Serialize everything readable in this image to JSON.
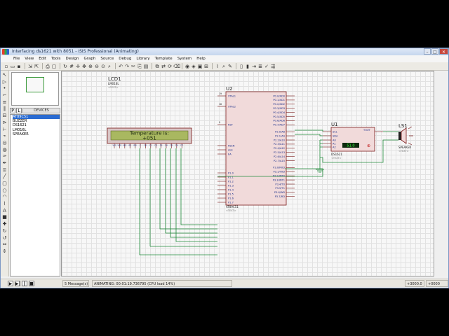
{
  "window": {
    "title": "Interfacing ds1621 with 8051 - ISIS Professional (Animating)",
    "controls": {
      "minimize": "–",
      "maximize": "□",
      "close": "✕"
    }
  },
  "menu": [
    "File",
    "View",
    "Edit",
    "Tools",
    "Design",
    "Graph",
    "Source",
    "Debug",
    "Library",
    "Template",
    "System",
    "Help"
  ],
  "picker": {
    "p_label": "P",
    "l_label": "L",
    "header": "DEVICES",
    "devices": [
      "AT89C51",
      "BUZZER",
      "DS1621",
      "LM016L",
      "SPEAKER"
    ],
    "selected": 0
  },
  "schematic": {
    "lcd": {
      "ref": "LCD1",
      "part": "LM016L",
      "text_tag": "<TEXT>",
      "line1": "Temperature is:",
      "line2": "+051",
      "pins": [
        "VSS",
        "VDD",
        "VEE",
        "RS",
        "RW",
        "E",
        "D0",
        "D1",
        "D2",
        "D3",
        "D4",
        "D5",
        "D6",
        "D7"
      ]
    },
    "mcu": {
      "ref": "U2",
      "part": "AT89C51",
      "text_tag": "<TEXT>",
      "left_pins": [
        "XTAL1",
        "XTAL2",
        "RST",
        "PSEN",
        "ALE",
        "EA",
        "P1.0",
        "P1.1",
        "P1.2",
        "P1.3",
        "P1.4",
        "P1.5",
        "P1.6",
        "P1.7"
      ],
      "right_pins": [
        "P0.0/AD0",
        "P0.1/AD1",
        "P0.2/AD2",
        "P0.3/AD3",
        "P0.4/AD4",
        "P0.5/AD5",
        "P0.6/AD6",
        "P0.7/AD7",
        "P2.0/A8",
        "P2.1/A9",
        "P2.2/A10",
        "P2.3/A11",
        "P2.4/A12",
        "P2.5/A13",
        "P2.6/A14",
        "P2.7/A15",
        "P3.0/RXD",
        "P3.1/TXD",
        "P3.2/INT0",
        "P3.3/INT1",
        "P3.4/T0",
        "P3.5/T1",
        "P3.6/WR",
        "P3.7/RD"
      ],
      "pin_numbers": {
        "xtal1": "19",
        "xtal2": "18",
        "rst": "9"
      }
    },
    "sensor": {
      "ref": "U1",
      "part": "DS1621",
      "text_tag": "<TEXT>",
      "pins": [
        "SCL",
        "SDA",
        "A0",
        "A1",
        "A2"
      ],
      "tout": "TOUT",
      "display": "51.0"
    },
    "speaker": {
      "ref": "LS1",
      "part": "SPEAKER",
      "text_tag": "<TEXT>"
    }
  },
  "status": {
    "messages": "5 Message(s)",
    "sim": "ANIMATING: 00:01:19.736795 (CPU load 14%)",
    "coord": "+3000.0",
    "coord2": "+0000"
  },
  "colors": {
    "lcd_bg": "#a9b860",
    "lcd_text": "#1d2a10",
    "component_fill": "#f1dada",
    "component_border": "#7a1a1a",
    "wire": "#1f8a3a",
    "pin_label": "#1a2f8a",
    "accent": "#2a6bd1"
  }
}
